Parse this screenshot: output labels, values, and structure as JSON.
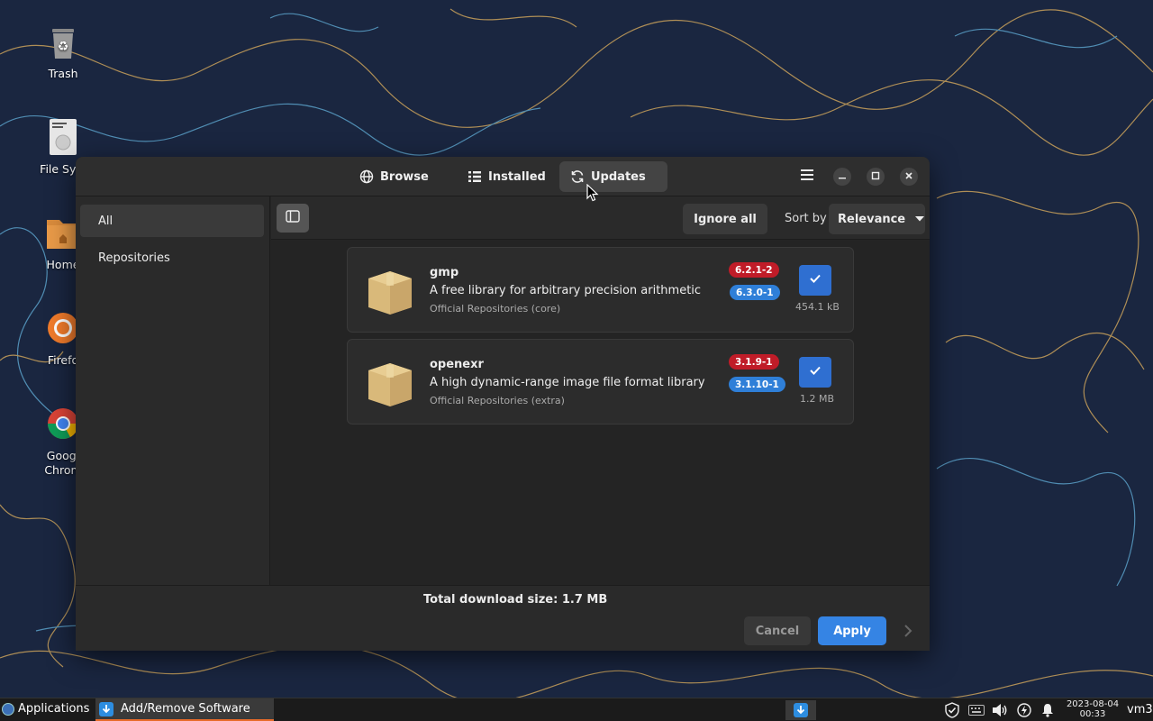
{
  "desktop": {
    "icons": [
      {
        "label": "Trash",
        "icon": "trash-icon"
      },
      {
        "label": "File Syst",
        "icon": "filesystem-icon"
      },
      {
        "label": "Home",
        "icon": "home-folder-icon"
      },
      {
        "label": "Firefo",
        "icon": "firefox-icon"
      },
      {
        "label": "Googl",
        "label2": "Chrom",
        "icon": "chrome-icon"
      }
    ]
  },
  "window": {
    "tabs": [
      {
        "label": "Browse",
        "icon": "globe-icon"
      },
      {
        "label": "Installed",
        "icon": "list-icon"
      },
      {
        "label": "Updates",
        "icon": "refresh-icon",
        "active": true
      }
    ],
    "sidebar": {
      "items": [
        {
          "label": "All",
          "selected": true
        },
        {
          "label": "Repositories"
        }
      ]
    },
    "toolbar": {
      "ignore_all_label": "Ignore all",
      "sort_label": "Sort by",
      "sort_value": "Relevance"
    },
    "packages": [
      {
        "name": "gmp",
        "description": "A free library for arbitrary precision arithmetic",
        "repository": "Official Repositories (core)",
        "old_version": "6.2.1-2",
        "new_version": "6.3.0-1",
        "size": "454.1 kB",
        "checked": true
      },
      {
        "name": "openexr",
        "description": "A high dynamic-range image file format library",
        "repository": "Official Repositories (extra)",
        "old_version": "3.1.9-1",
        "new_version": "3.1.10-1",
        "size": "1.2 MB",
        "checked": true
      }
    ],
    "footer": {
      "total_label": "Total download size: 1.7 MB",
      "cancel_label": "Cancel",
      "apply_label": "Apply"
    }
  },
  "taskbar": {
    "applications_label": "Applications",
    "task_label": "Add/Remove Software",
    "clock_date": "2023-08-04",
    "clock_time": "00:33",
    "hostname": "vm3"
  },
  "colors": {
    "accent": "#3584e4",
    "old_version_badge": "#c01c28",
    "new_version_badge": "#2f7fd8",
    "taskbar_active_underline": "#e86c2a"
  }
}
